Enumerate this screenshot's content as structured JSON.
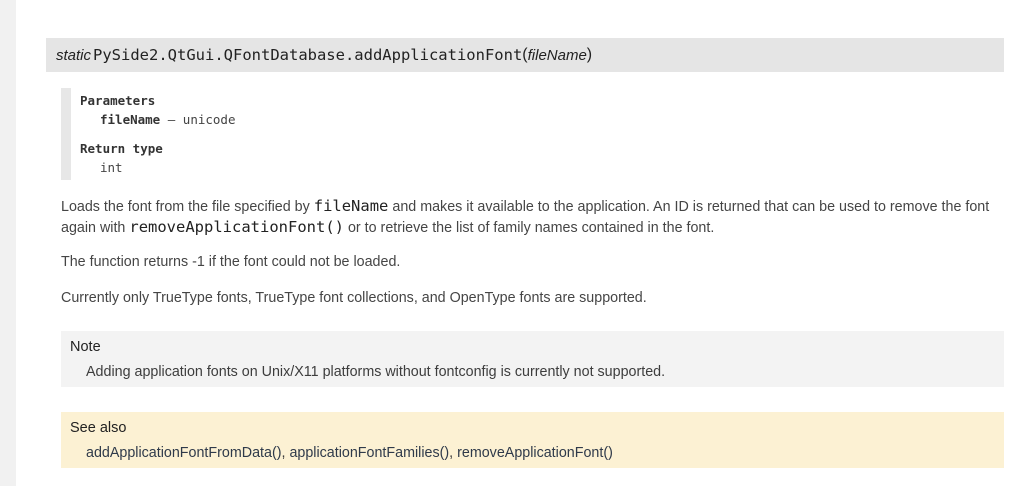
{
  "signature": {
    "prefix": "static",
    "name": "PySide2.QtGui.QFontDatabase.addApplicationFont",
    "open_paren": "(",
    "arg": "fileName",
    "close_paren": ")"
  },
  "fields": {
    "params_title": "Parameters",
    "param_name": "fileName",
    "param_sep": " – ",
    "param_type": "unicode",
    "return_title": "Return type",
    "return_value": "int"
  },
  "desc": {
    "p1_a": "Loads the font from the file specified by ",
    "p1_code1": "fileName",
    "p1_b": " and makes it available to the application. An ID is returned that can be used to remove the font again with ",
    "p1_code2": "removeApplicationFont()",
    "p1_c": " or to retrieve the list of family names contained in the font.",
    "p2": "The function returns -1 if the font could not be loaded.",
    "p3": "Currently only TrueType fonts, TrueType font collections, and OpenType fonts are supported."
  },
  "note": {
    "title": "Note",
    "body": "Adding application fonts on Unix/X11 platforms without fontconfig is currently not supported."
  },
  "see_also": {
    "title": "See also",
    "link1": "addApplicationFontFromData()",
    "sep1": ", ",
    "link2": "applicationFontFamilies()",
    "sep2": ", ",
    "link3": "removeApplicationFont()"
  }
}
